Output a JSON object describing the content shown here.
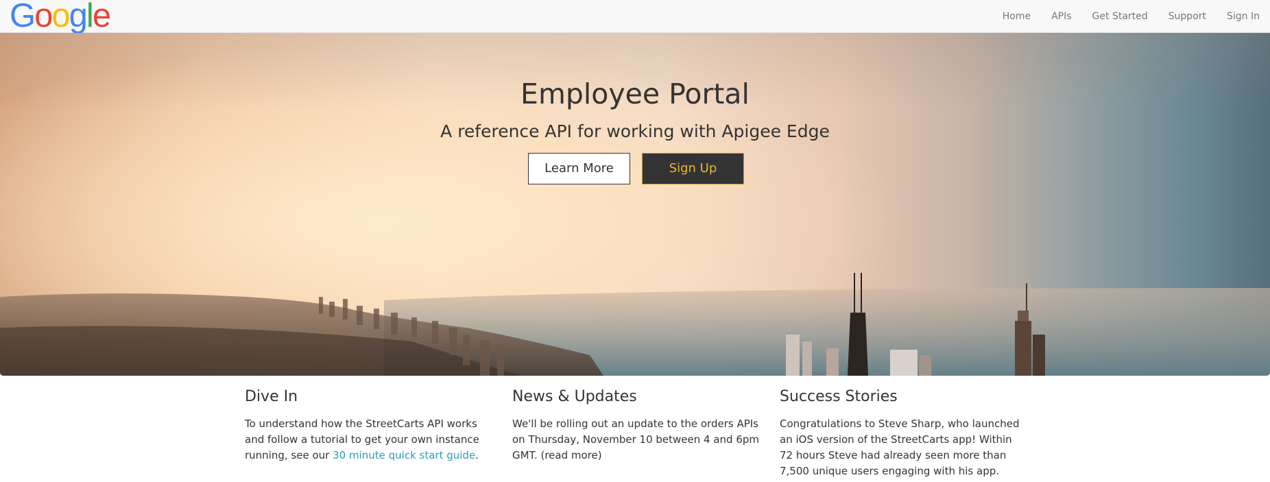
{
  "logo": {
    "letters": [
      {
        "char": "G",
        "color": "#4285F4"
      },
      {
        "char": "o",
        "color": "#EA4335"
      },
      {
        "char": "o",
        "color": "#FBBC05"
      },
      {
        "char": "g",
        "color": "#4285F4"
      },
      {
        "char": "l",
        "color": "#34A853"
      },
      {
        "char": "e",
        "color": "#EA4335"
      }
    ]
  },
  "nav": {
    "items": [
      {
        "label": "Home"
      },
      {
        "label": "APIs"
      },
      {
        "label": "Get Started"
      },
      {
        "label": "Support"
      },
      {
        "label": "Sign In"
      }
    ]
  },
  "hero": {
    "title": "Employee Portal",
    "subtitle": "A reference API for working with Apigee Edge",
    "learn_more_label": "Learn More",
    "sign_up_label": "Sign Up"
  },
  "columns": {
    "dive_in": {
      "heading": "Dive In",
      "text_before": "To understand how the StreetCarts API works and follow a tutorial to get your own instance running, see our ",
      "link_text": "30 minute quick start guide",
      "text_after": "."
    },
    "news": {
      "heading": "News & Updates",
      "text": "We'll be rolling out an update to the orders APIs on Thursday, November 10 between 4 and 6pm GMT. (read more)"
    },
    "success": {
      "heading": "Success Stories",
      "text": "Congratulations to Steve Sharp, who launched an iOS version of the StreetCarts app! Within 72 hours Steve had already seen more than 7,500 unique users engaging with his app."
    }
  },
  "colors": {
    "link": "#2a9fbc",
    "button_dark": "#333333",
    "button_accent": "#f0b429"
  }
}
